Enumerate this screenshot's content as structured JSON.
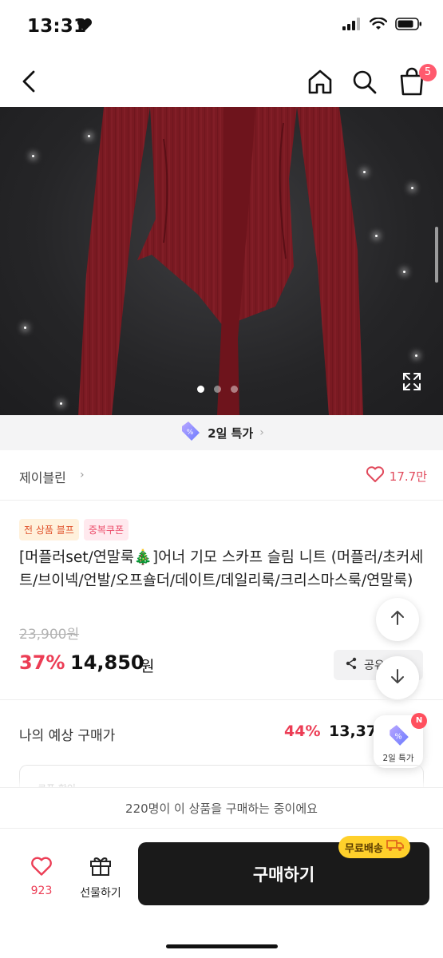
{
  "status_bar": {
    "time": "13:31"
  },
  "nav": {
    "cart_count": "5"
  },
  "hero": {
    "total_images": 3,
    "active_index": 0
  },
  "deal_strip": {
    "label": "2일 특가"
  },
  "seller": {
    "name": "제이블린",
    "likes": "17.7만"
  },
  "badges": {
    "sale": "전 상품 블프",
    "coupon": "중복쿠폰"
  },
  "product": {
    "title": "[머플러set/연말룩🎄]어너 기모 스카프 슬림 니트 (머플러/초커세트/브이넥/언발/오프숄더/데이트/데일리룩/크리스마스룩/연말룩)",
    "original_price": "23,900원",
    "discount_rate": "37%",
    "price": "14,850",
    "price_unit": "원"
  },
  "share": {
    "label": "공유"
  },
  "expected": {
    "label": "나의 예상 구매가",
    "discount_rate": "44%",
    "price": "13,37"
  },
  "float_deal": {
    "label": "2일 특가",
    "badge": "N"
  },
  "coupon_card": {
    "text": "쿠폰 할인"
  },
  "viewers": {
    "text": "220명이 이 상품을 구매하는 중이에요"
  },
  "bottom": {
    "like_count": "923",
    "gift_label": "선물하기",
    "buy_label": "구매하기",
    "free_shipping": "무료배송"
  },
  "colors": {
    "accent": "#ec3d55",
    "buy_button": "#1a1a1a",
    "free_ship": "#ffd02b",
    "garment": "#7a1a22"
  }
}
